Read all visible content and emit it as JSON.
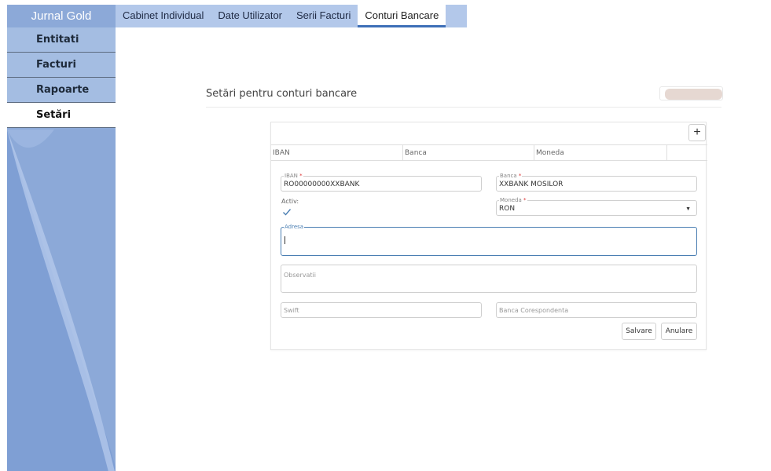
{
  "app": {
    "brand": "Jurnal Gold"
  },
  "tabs": [
    {
      "label": "Cabinet Individual"
    },
    {
      "label": "Date Utilizator"
    },
    {
      "label": "Serii Facturi"
    },
    {
      "label": "Conturi Bancare",
      "active": true
    }
  ],
  "sidebar": {
    "items": [
      {
        "label": "Entitati"
      },
      {
        "label": "Facturi"
      },
      {
        "label": "Rapoarte"
      },
      {
        "label": "Setări",
        "active": true
      }
    ]
  },
  "page": {
    "title": "Setări pentru conturi bancare"
  },
  "grid": {
    "add_label": "+",
    "columns": [
      "IBAN",
      "Banca",
      "Moneda",
      ""
    ]
  },
  "form": {
    "iban": {
      "label": "IBAN",
      "required": "*",
      "value": "RO00000000XXBANK"
    },
    "banca": {
      "label": "Banca",
      "required": "*",
      "value": "XXBANK MOSILOR"
    },
    "activ": {
      "label": "Activ:",
      "checked": true
    },
    "moneda": {
      "label": "Moneda",
      "required": "*",
      "value": "RON"
    },
    "adresa": {
      "label": "Adresa",
      "value": ""
    },
    "observatii": {
      "placeholder": "Observatii"
    },
    "swift": {
      "placeholder": "Swift"
    },
    "banca_corespondenta": {
      "placeholder": "Banca Corespondenta"
    },
    "save_label": "Salvare",
    "cancel_label": "Anulare"
  },
  "colors": {
    "brand_bg": "#8ca9d8",
    "tab_bar": "#b3c8ea",
    "active_underline": "#3d6fb7",
    "focus": "#4b7fb3"
  }
}
